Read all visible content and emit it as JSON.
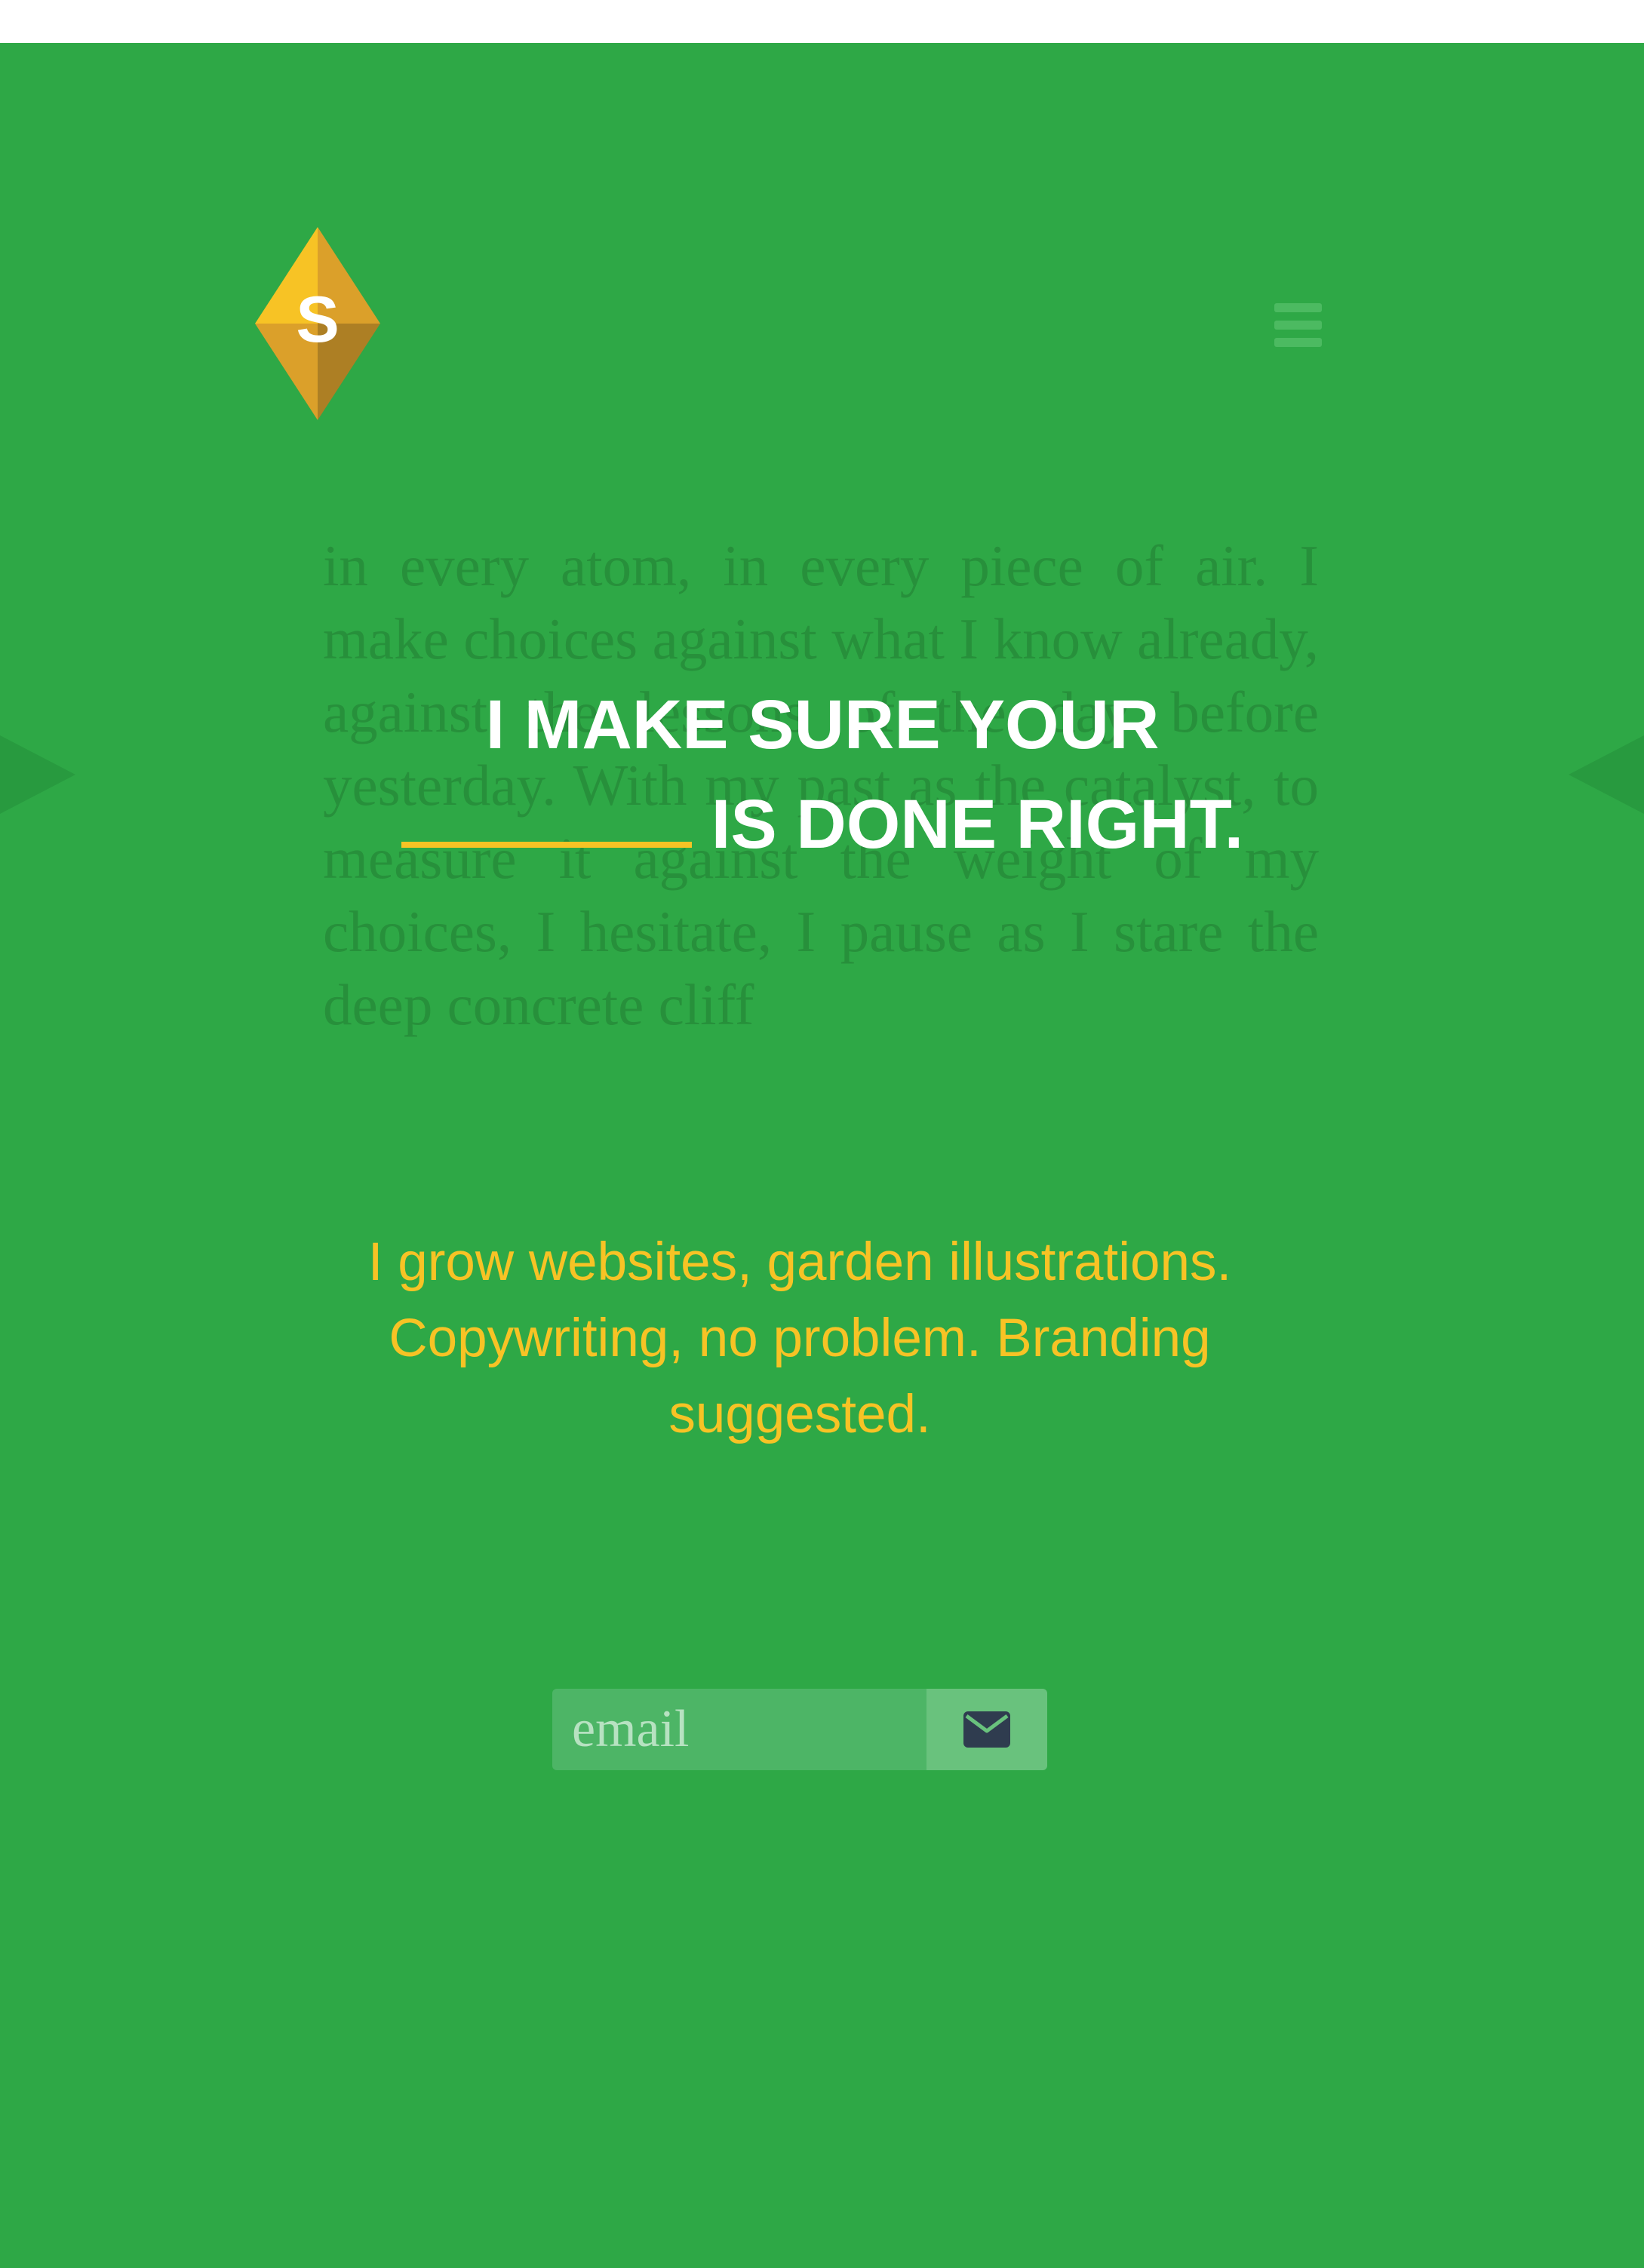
{
  "colors": {
    "background": "#2ea846",
    "accent": "#f7c325",
    "headline": "#ffffff",
    "icon_dark": "#2f3c4f"
  },
  "logo": {
    "letter": "S",
    "icon": "diamond-logo-icon"
  },
  "header": {
    "menu_icon": "hamburger-menu-icon"
  },
  "background_text": "in every atom, in every piece of air. I make choices against what I know already, against the lessons of the day before yesterday. With my past as the catalyst, to measure it against the weight of my choices, I hesitate, I pause as I stare the deep concrete cliff",
  "headline": {
    "line1": "I MAKE SURE YOUR",
    "line2": "IS DONE RIGHT."
  },
  "tagline": "I grow websites, garden illustrations. Copywriting, no problem. Branding suggested.",
  "signup": {
    "placeholder": "email",
    "submit_icon": "envelope-icon"
  },
  "carousel": {
    "prev_icon": "arrow-left-icon",
    "next_icon": "arrow-right-icon"
  }
}
